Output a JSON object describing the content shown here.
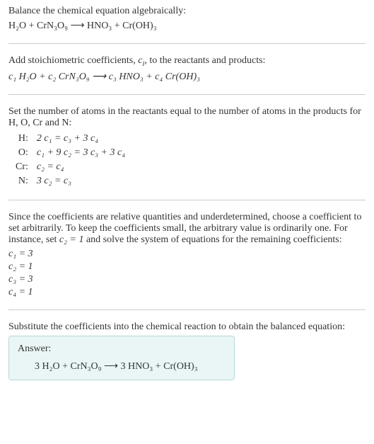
{
  "section1": {
    "prompt": "Balance the chemical equation algebraically:",
    "equation": "H₂O + CrN₃O₉ ⟶ HNO₃ + Cr(OH)₃"
  },
  "section2": {
    "text_a": "Add stoichiometric coefficients, ",
    "ci": "c",
    "ci_sub": "i",
    "text_b": ", to the reactants and products:",
    "equation": "c₁ H₂O + c₂ CrN₃O₉ ⟶ c₃ HNO₃ + c₄ Cr(OH)₃"
  },
  "section3": {
    "intro": "Set the number of atoms in the reactants equal to the number of atoms in the products for H, O, Cr and N:",
    "rows": [
      {
        "label": "H:",
        "eq": "2 c₁ = c₃ + 3 c₄"
      },
      {
        "label": "O:",
        "eq": "c₁ + 9 c₂ = 3 c₃ + 3 c₄"
      },
      {
        "label": "Cr:",
        "eq": "c₂ = c₄"
      },
      {
        "label": "N:",
        "eq": "3 c₂ = c₃"
      }
    ]
  },
  "section4": {
    "text_a": "Since the coefficients are relative quantities and underdetermined, choose a coefficient to set arbitrarily. To keep the coefficients small, the arbitrary value is ordinarily one. For instance, set ",
    "c2": "c₂ = 1",
    "text_b": " and solve the system of equations for the remaining coefficients:",
    "coefs": [
      "c₁ = 3",
      "c₂ = 1",
      "c₃ = 3",
      "c₄ = 1"
    ]
  },
  "section5": {
    "text": "Substitute the coefficients into the chemical reaction to obtain the balanced equation:",
    "answer_label": "Answer:",
    "answer_eq": "3 H₂O + CrN₃O₉ ⟶ 3 HNO₃ + Cr(OH)₃"
  }
}
